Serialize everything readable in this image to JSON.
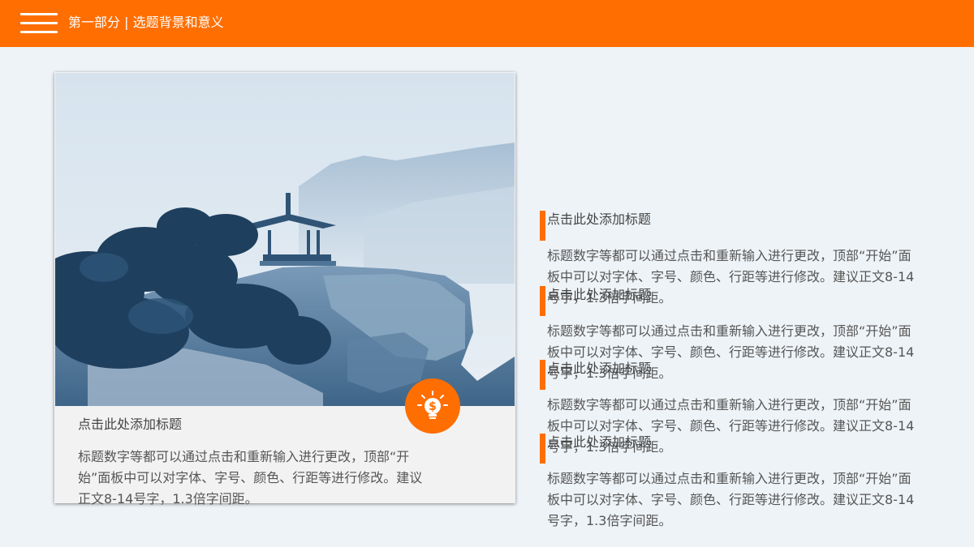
{
  "header": {
    "menu_icon": "hamburger-menu-icon",
    "title": "第一部分 | 选题背景和意义",
    "brand_color": "#ff6e00"
  },
  "card": {
    "image": "pavilion-on-cliff-landscape",
    "badge_icon": "lightbulb-dollar-icon",
    "title": "点击此处添加标题",
    "body": "标题数字等都可以通过点击和重新输入进行更改，顶部“开始”面板中可以对字体、字号、颜色、行距等进行修改。建议正文8-14号字，1.3倍字间距。"
  },
  "items": [
    {
      "title": "点击此处添加标题",
      "body": "标题数字等都可以通过点击和重新输入进行更改，顶部“开始”面板中可以对字体、字号、颜色、行距等进行修改。建议正文8-14号字，1.3倍字间距。"
    },
    {
      "title": "点击此处添加标题",
      "body": "标题数字等都可以通过点击和重新输入进行更改，顶部“开始”面板中可以对字体、字号、颜色、行距等进行修改。建议正文8-14号字，1.3倍字间距。"
    },
    {
      "title": "点击此处添加标题",
      "body": "标题数字等都可以通过点击和重新输入进行更改，顶部“开始”面板中可以对字体、字号、颜色、行距等进行修改。建议正文8-14号字，1.3倍字间距。"
    },
    {
      "title": "点击此处添加标题",
      "body": "标题数字等都可以通过点击和重新输入进行更改，顶部“开始”面板中可以对字体、字号、颜色、行距等进行修改。建议正文8-14号字，1.3倍字间距。"
    }
  ]
}
